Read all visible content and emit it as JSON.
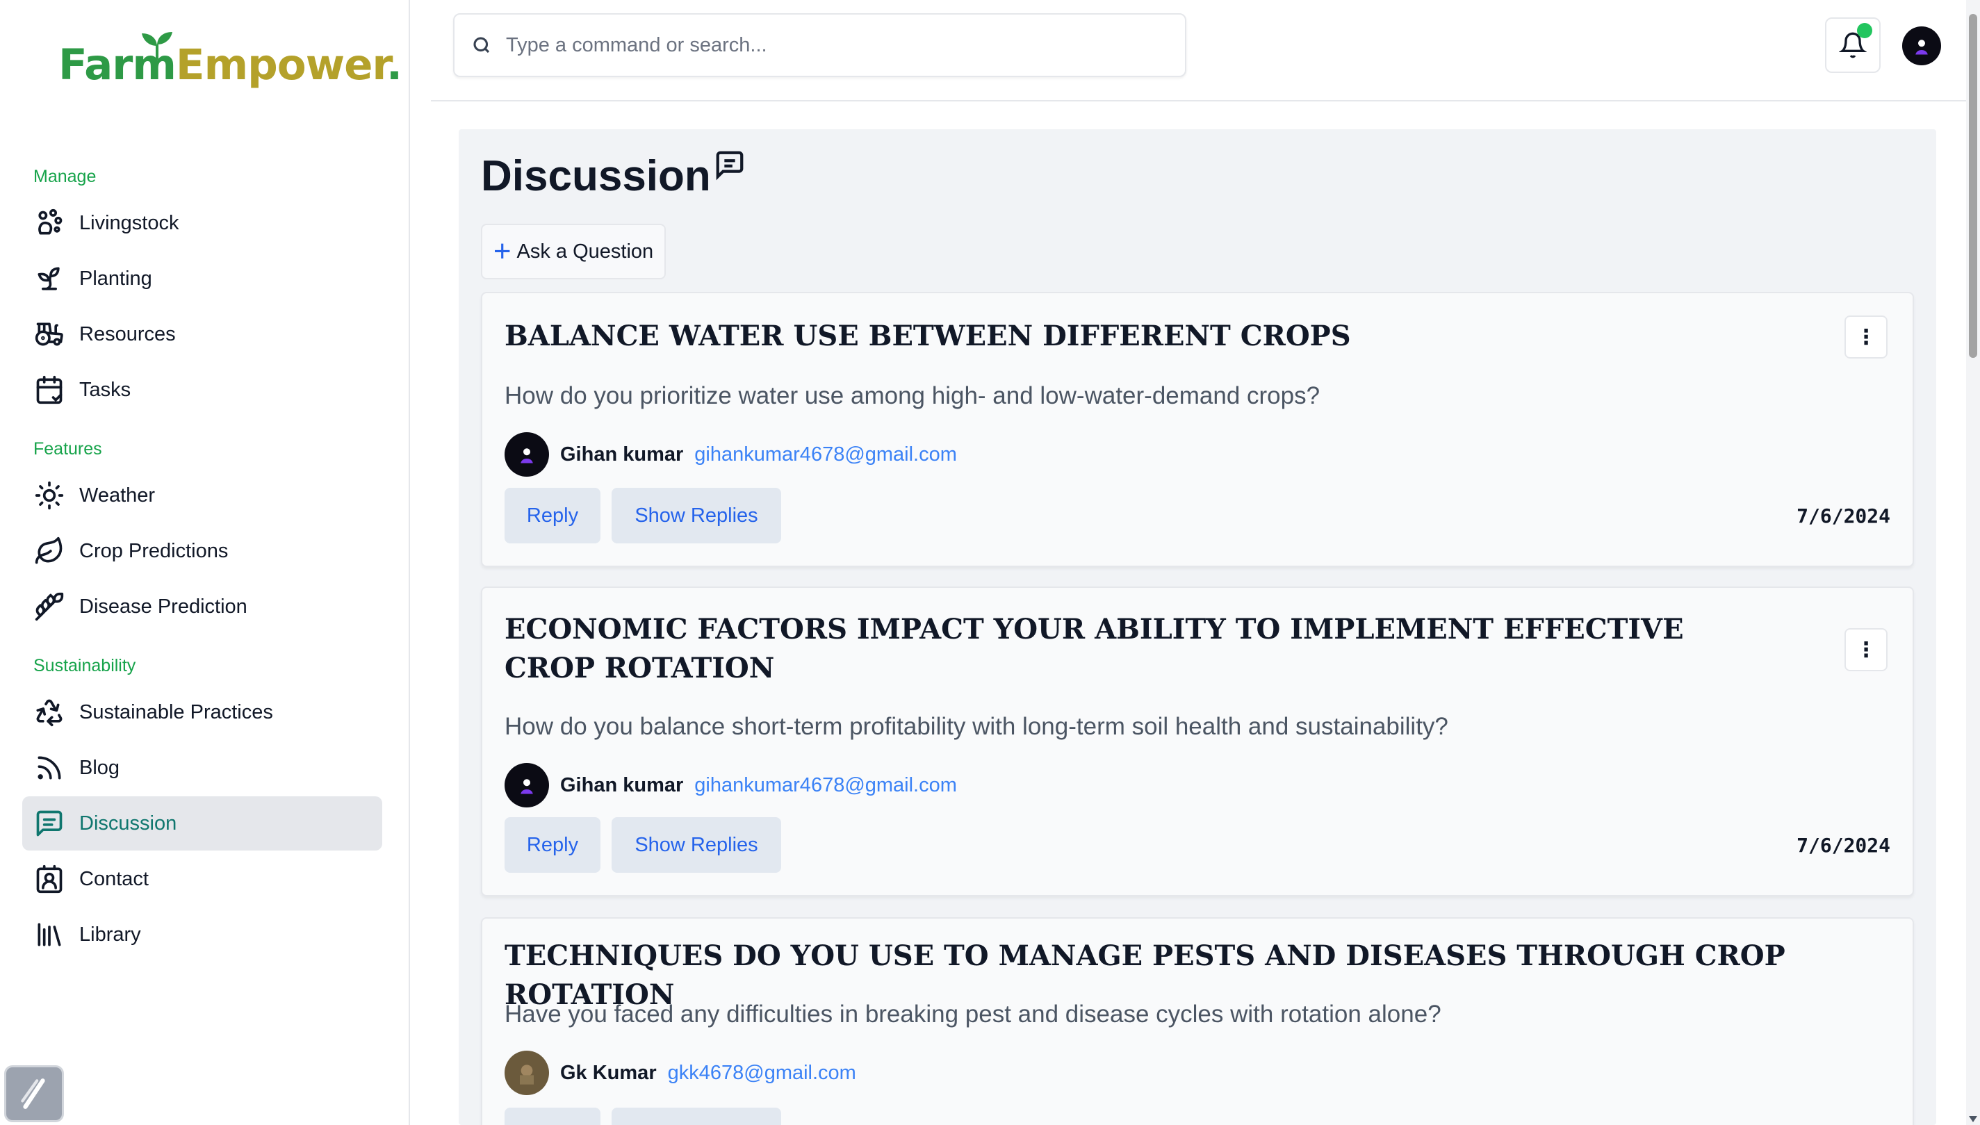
{
  "brand": {
    "part1": "Farm",
    "part2": "Empower",
    "dot": "."
  },
  "sidebar": {
    "sections": [
      {
        "label": "Manage"
      },
      {
        "label": "Features"
      },
      {
        "label": "Sustainability"
      }
    ],
    "items": [
      {
        "label": "Livingstock",
        "icon": "livestock-icon"
      },
      {
        "label": "Planting",
        "icon": "sprout-icon"
      },
      {
        "label": "Resources",
        "icon": "tractor-icon"
      },
      {
        "label": "Tasks",
        "icon": "calendar-check-icon"
      },
      {
        "label": "Weather",
        "icon": "sun-icon"
      },
      {
        "label": "Crop Predictions",
        "icon": "leaf-icon"
      },
      {
        "label": "Disease Prediction",
        "icon": "wheat-icon"
      },
      {
        "label": "Sustainable Practices",
        "icon": "recycle-icon"
      },
      {
        "label": "Blog",
        "icon": "rss-icon"
      },
      {
        "label": "Discussion",
        "icon": "message-square-icon",
        "active": true
      },
      {
        "label": "Contact",
        "icon": "contact-icon"
      },
      {
        "label": "Library",
        "icon": "library-icon"
      }
    ]
  },
  "header": {
    "search_placeholder": "Type a command or search...",
    "notification_dot_color": "#22c55e"
  },
  "main": {
    "title": "Discussion",
    "ask_button": "Ask a Question",
    "reply_label": "Reply",
    "show_replies_label": "Show Replies",
    "posts": [
      {
        "title": "BALANCE WATER USE BETWEEN DIFFERENT CROPS",
        "body": "How do you prioritize water use among high- and low-water-demand crops?",
        "author": "Gihan kumar",
        "email": "gihankumar4678@gmail.com",
        "date": "7/6/2024"
      },
      {
        "title": "ECONOMIC FACTORS IMPACT YOUR ABILITY TO IMPLEMENT EFFECTIVE CROP ROTATION",
        "body": "How do you balance short-term profitability with long-term soil health and sustainability?",
        "author": "Gihan kumar",
        "email": "gihankumar4678@gmail.com",
        "date": "7/6/2024"
      },
      {
        "title": "TECHNIQUES DO YOU USE TO MANAGE PESTS AND DISEASES THROUGH CROP ROTATION",
        "body": "Have you faced any difficulties in breaking pest and disease cycles with rotation alone?",
        "author": "Gk Kumar",
        "email": "gkk4678@gmail.com",
        "date": ""
      }
    ]
  },
  "colors": {
    "brand_green": "#2e9a46",
    "brand_gold": "#b4a12a",
    "section_green": "#16a34a",
    "active_teal": "#0f766e",
    "link_blue": "#3b82f6"
  }
}
